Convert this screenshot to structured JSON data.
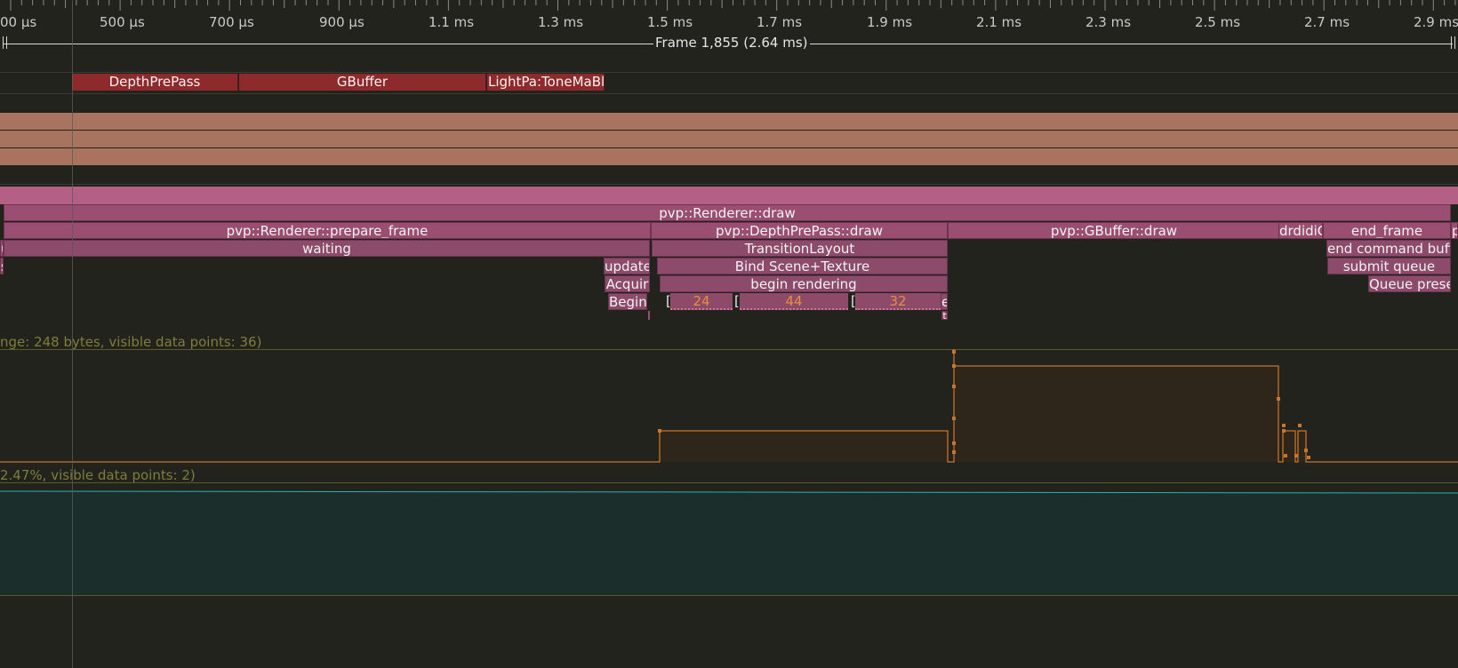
{
  "ruler": {
    "ticks": [
      "00 µs",
      "500 µs",
      "700 µs",
      "900 µs",
      "1.1 ms",
      "1.3 ms",
      "1.5 ms",
      "1.7 ms",
      "1.9 ms",
      "2.1 ms",
      "2.3 ms",
      "2.5 ms",
      "2.7 ms",
      "2.9 ms"
    ]
  },
  "frame": {
    "label": "Frame 1,855 (2.64 ms)"
  },
  "gpu_zones": {
    "depth": "DepthPrePass",
    "gbuffer": "GBuffer",
    "light": "LightPa:ToneMaBl"
  },
  "cpu_zones": {
    "draw": "pvp::Renderer::draw",
    "prepare": "pvp::Renderer::prepare_frame",
    "depth_draw": "pvp::DepthPrePass::draw",
    "gbuffer_draw": "pvp::GBuffer::draw",
    "gbuffer_tail": "drdidiC",
    "end_frame": "end_frame",
    "end_frame_right": "p",
    "waiting": "waiting",
    "transition": "TransitionLayout",
    "end_cmd": "end command buff",
    "update": "update",
    "bind": "Bind Scene+Texture",
    "submit": "submit queue",
    "acquire": "Acquir",
    "begin_rendering": "begin rendering",
    "queue_present": "Queue prese",
    "begin": "Begin",
    "left_u": "u",
    "left_s": "s",
    "sub1_open": "[",
    "sub1_val": "24",
    "sub2_open": "[",
    "sub2_val": "44",
    "sub3_open": "[",
    "sub3_val": "32",
    "sub_e": "e",
    "sub_t": "t"
  },
  "plots": {
    "memory_label": "nge: 248 bytes, visible data points: 36)",
    "cpu_label": "2.47%, visible data points: 2)"
  },
  "colors": {
    "background": "#23231e",
    "gpu_zone": "#8f2a2c",
    "cpu_zone": "#9a4f72",
    "plot_line": "#c8742a",
    "teal_plot": "#1c2e2b"
  }
}
